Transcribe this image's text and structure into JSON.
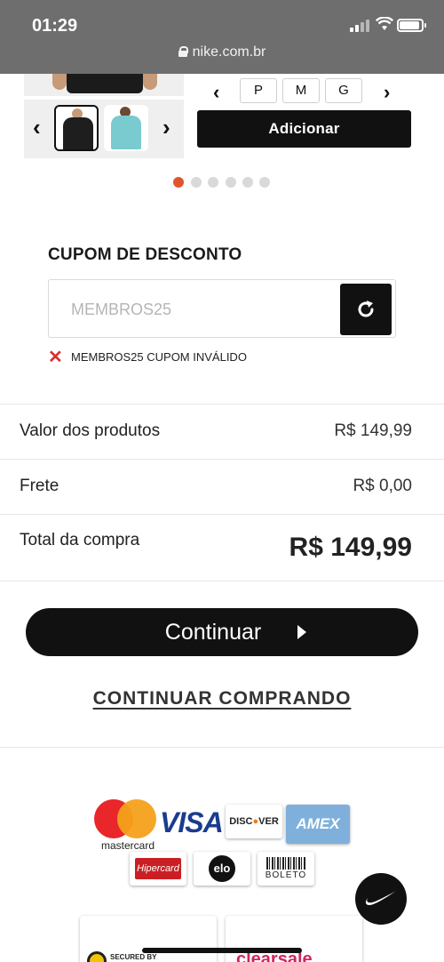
{
  "status_bar": {
    "time": "01:29",
    "url": "nike.com.br"
  },
  "product": {
    "sizes": [
      "P",
      "M",
      "G"
    ],
    "add_label": "Adicionar",
    "carousel_dots": 6,
    "active_dot": 1
  },
  "coupon": {
    "title": "CUPOM DE DESCONTO",
    "value": "MEMBROS25",
    "error": "MEMBROS25 CUPOM INVÁLIDO"
  },
  "summary": {
    "products_label": "Valor dos produtos",
    "products_value": "R$ 149,99",
    "shipping_label": "Frete",
    "shipping_value": "R$ 0,00",
    "total_label": "Total da compra",
    "total_value": "R$ 149,99"
  },
  "actions": {
    "continue_label": "Continuar",
    "keep_shopping_label": "CONTINUAR COMPRANDO"
  },
  "payments": {
    "mastercard": "mastercard",
    "visa": "VISA",
    "discover_pre": "DISC",
    "discover_post": "VER",
    "amex": "AMEX",
    "hipercard": "Hipercard",
    "elo": "elo",
    "boleto": "BOLETO"
  },
  "seals": {
    "secured": "SECURED BY",
    "clearsale": "clearsale"
  },
  "colors": {
    "accent": "#e2552b",
    "error": "#d8312d",
    "button": "#111111"
  }
}
